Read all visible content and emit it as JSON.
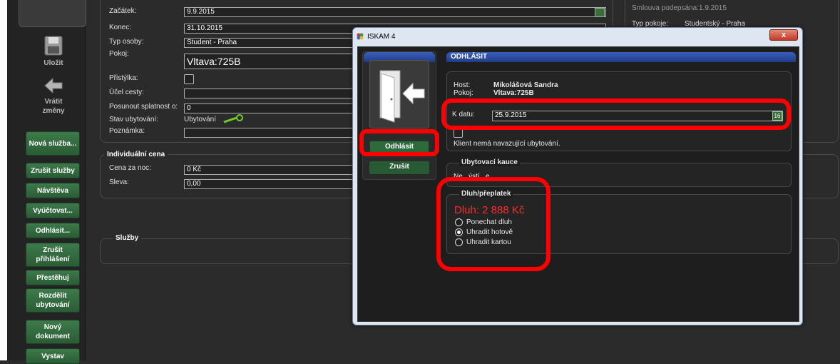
{
  "toolbar": {
    "save_label": "Uložit",
    "revert_label_line1": "Vrátit",
    "revert_label_line2": "změny",
    "buttons": [
      "Nová služba...",
      "Zrušit služby",
      "Návštěva",
      "Vyúčtovat...",
      "Odhlásit...",
      "Zrušit přihlášení",
      "Přestěhuj",
      "Rozdělit ubytování",
      "Nový dokument",
      "Vystav"
    ]
  },
  "form": {
    "start_label": "Začátek:",
    "start_value": "9.9.2015",
    "end_label": "Konec:",
    "end_value": "31.10.2015",
    "person_type_label": "Typ osoby:",
    "person_type_value": "Student - Praha",
    "room_label": "Pokoj:",
    "room_value": "Vltava:725B",
    "extra_bed_label": "Přistýlka:",
    "purpose_label": "Účel cesty:",
    "postpone_label": "Posunout splatnost o:",
    "postpone_value": "0",
    "status_label": "Stav ubytování:",
    "status_value": "Ubytování",
    "note_label": "Poznámka:",
    "individual_price_title": "Individuální cena",
    "price_per_night_label": "Cena za noc:",
    "price_per_night_value": "0 Kč",
    "discount_label": "Sleva:",
    "discount_value": "0,00",
    "services_title": "Služby"
  },
  "right_info": {
    "contract_label": "Smlouva podepsána:",
    "contract_value": "1.9.2015",
    "room_type_label": "Typ pokoje:",
    "room_type_value": "Studentský - Praha"
  },
  "dialog": {
    "window_title": "ISKAM 4",
    "close_label": "x",
    "header": "ODHLÁSIT",
    "host_label": "Host:",
    "host_value": "Mikolášová Sandra",
    "room_label": "Pokoj:",
    "room_value": "Vltava:725B",
    "date_label": "K datu:",
    "date_value": "25.9.2015",
    "calendar_day": "16",
    "no_followup_text": "Klient nemá navazující ubytování.",
    "checkout_button": "Odhlásit",
    "cancel_button": "Zrušit",
    "deposit_title": "Ubytovací kauce",
    "deposit_text": "Ne...ýstí...e.",
    "debt_title": "Dluh/přeplatek",
    "debt_amount": "Dluh: 2 888 Kč",
    "options": [
      "Ponechat dluh",
      "Uhradit hotově",
      "Uhradit kartou"
    ],
    "selected_option": 1
  },
  "colors": {
    "accent_green": "#2f6a3c",
    "highlight_red": "#ff0000",
    "dialog_header_blue": "#2a4aa0",
    "debt_red": "#ff2a2a"
  }
}
